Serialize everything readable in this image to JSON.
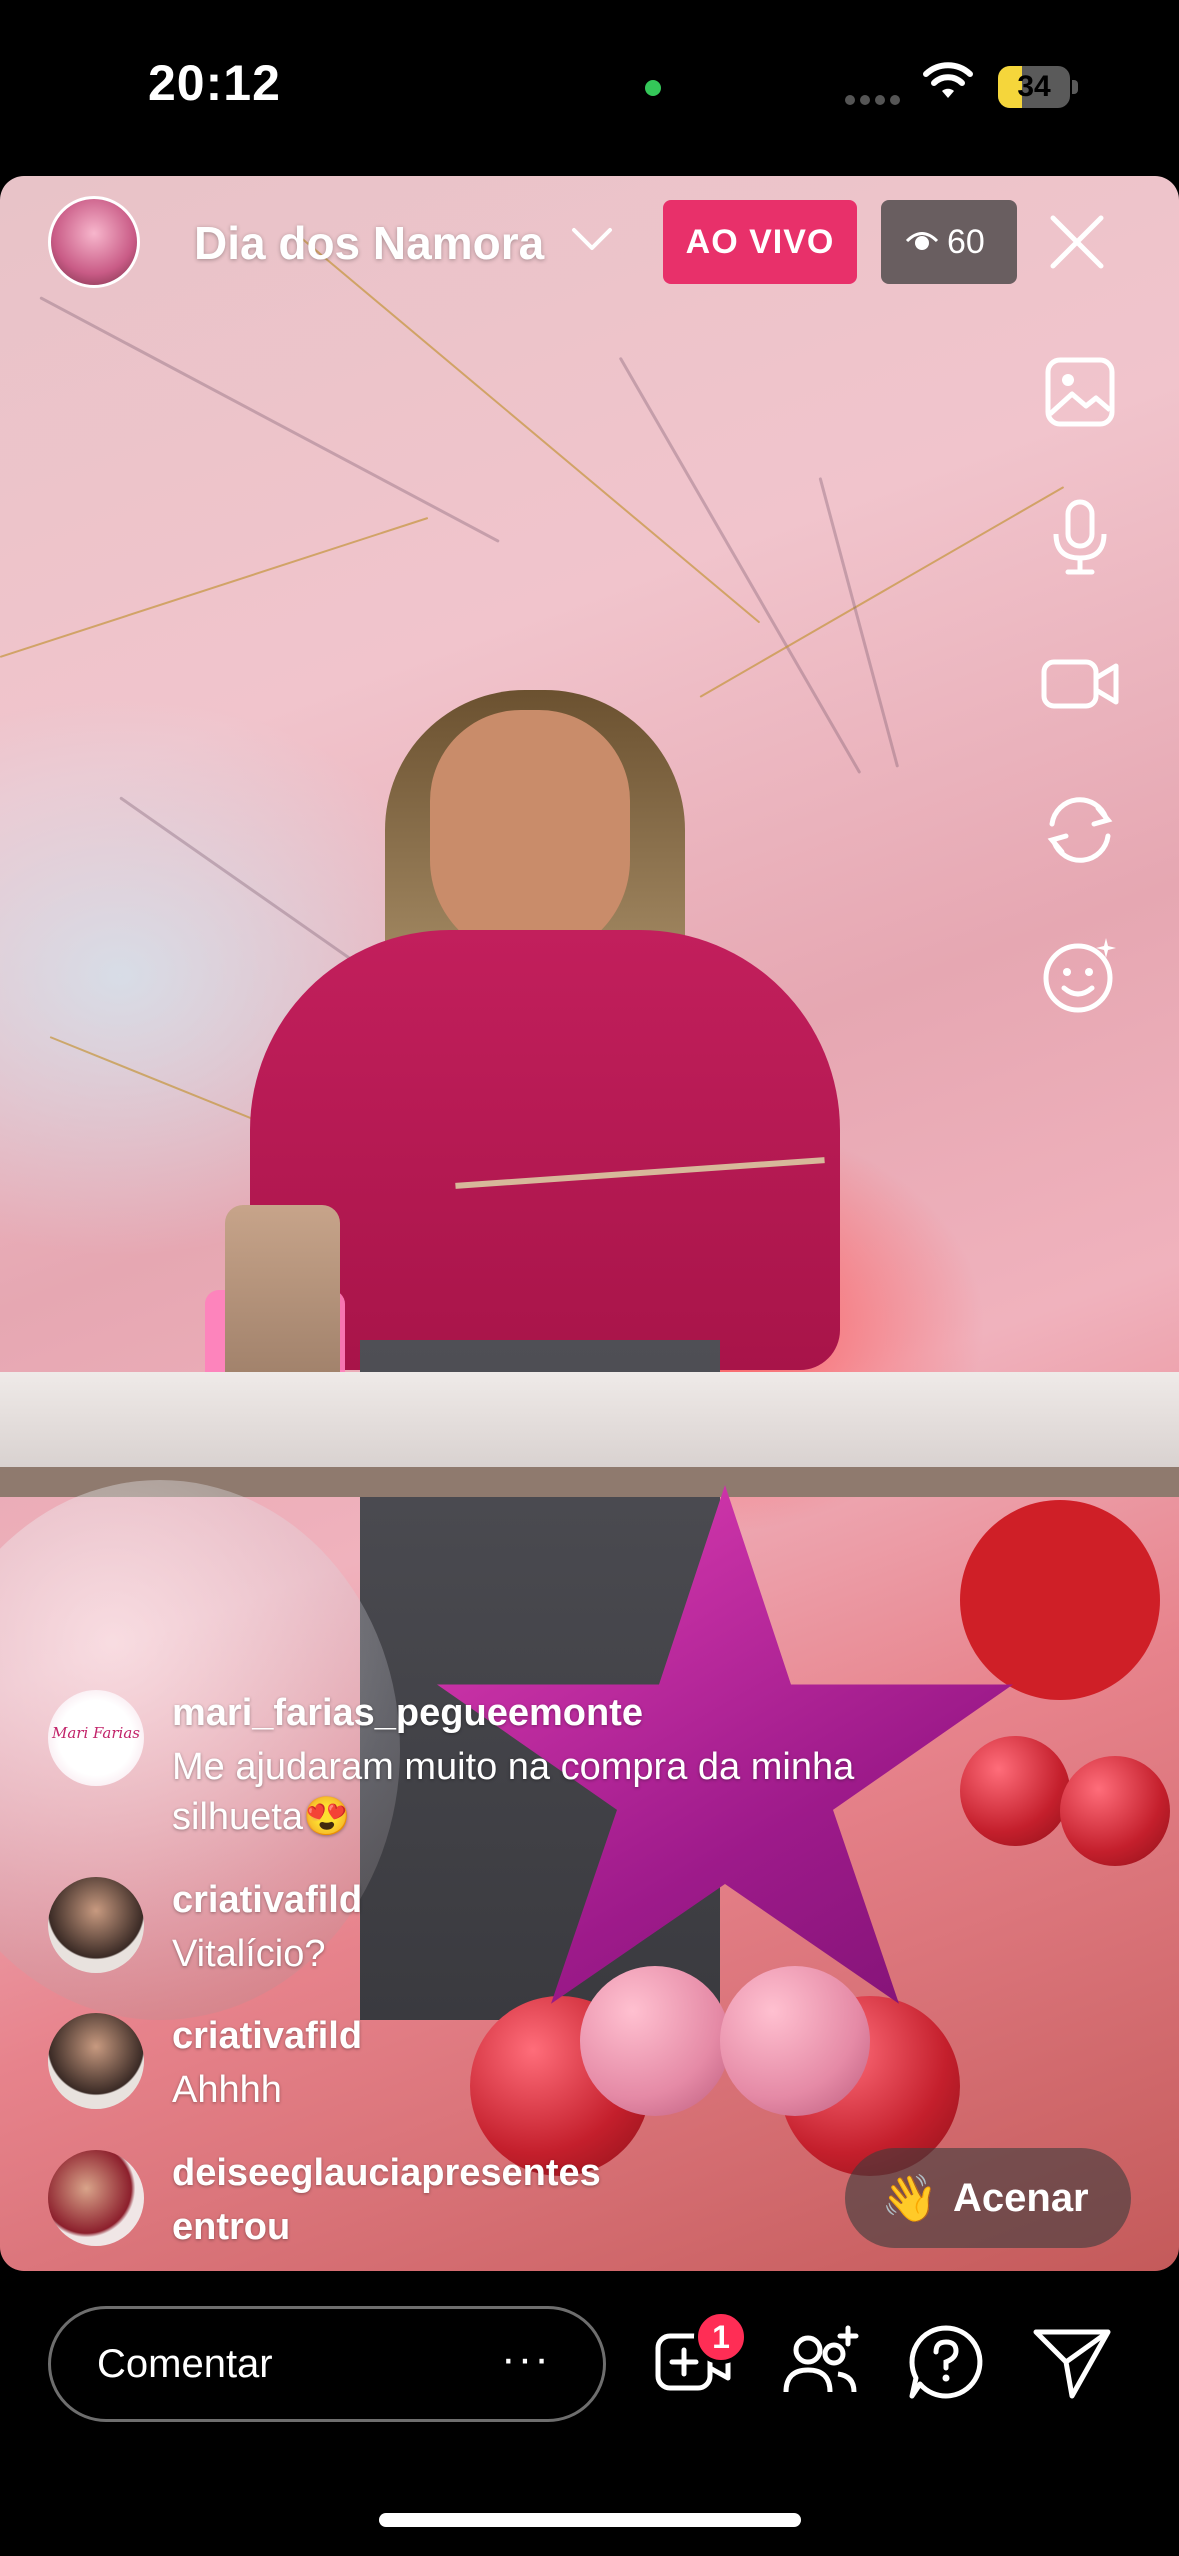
{
  "status_bar": {
    "time": "20:12",
    "battery": "34",
    "battery_level": 0.34
  },
  "live": {
    "title": "Dia dos Namora",
    "badge": "AO VIVO",
    "viewer_count": "60"
  },
  "side_tools": [
    "gallery-icon",
    "microphone-icon",
    "video-camera-icon",
    "flip-camera-icon",
    "face-effects-icon"
  ],
  "comments": [
    {
      "user": "mari_farias_pegueemonte",
      "avatar_text": "Mari Farias",
      "text": "Me ajudaram muito na compra da minha silhueta😍"
    },
    {
      "user": "criativafild",
      "text": "Vitalício?"
    },
    {
      "user": "criativafild",
      "text": "Ahhhh"
    },
    {
      "user": "deiseeglauciapresentes",
      "text": "entrou"
    }
  ],
  "wave_button": {
    "emoji": "👋",
    "label": "Acenar"
  },
  "bottom_bar": {
    "comment_placeholder": "Comentar",
    "more": "···",
    "add_guest_badge": "1"
  },
  "colors": {
    "live_badge": "#e8306a",
    "notification": "#ff2d55",
    "battery": "#f5d63b"
  }
}
